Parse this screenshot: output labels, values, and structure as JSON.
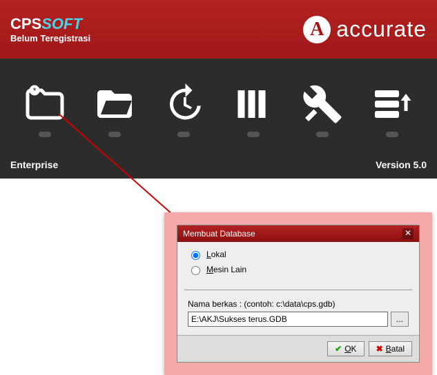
{
  "header": {
    "brand_cps": "CPS",
    "brand_soft": "SOFT",
    "subtitle": "Belum Teregistrasi",
    "accurate_icon": "A",
    "accurate_text": "accurate"
  },
  "toolbar": {
    "items": [
      {
        "name": "new-db-icon"
      },
      {
        "name": "open-db-icon"
      },
      {
        "name": "history-icon"
      },
      {
        "name": "company-icon"
      },
      {
        "name": "tools-icon"
      },
      {
        "name": "server-icon"
      }
    ]
  },
  "footer": {
    "left": "Enterprise",
    "right": "Version 5.0"
  },
  "dialog": {
    "title": "Membuat Database",
    "radio_lokal": "Lokal",
    "radio_mesin": "Mesin Lain",
    "file_label": "Nama berkas :   (contoh: c:\\data\\cps.gdb)",
    "file_value": "E:\\AKJ\\Sukses terus.GDB",
    "browse_label": "...",
    "ok_label": "OK",
    "batal_label": "Batal"
  }
}
